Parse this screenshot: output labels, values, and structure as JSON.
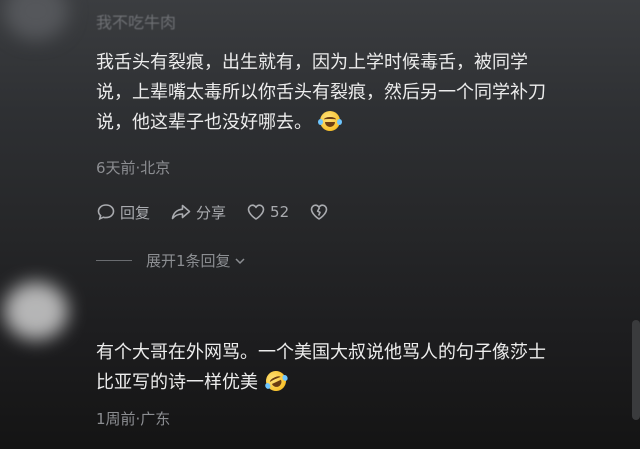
{
  "comments": [
    {
      "username": "我不吃牛肉",
      "lines": [
        "我舌头有裂痕，出生就有，因为上学时候毒舌，被同学",
        "说，上辈嘴太毒所以你舌头有裂痕，然后另一个同学补刀",
        "说，他这辈子也没好哪去。"
      ],
      "emoji": "grinning-with-tears-emoji",
      "time_location": "6天前·北京",
      "reply_label": "回复",
      "share_label": "分享",
      "like_count": "52",
      "expand_replies_label": "展开1条回复"
    },
    {
      "lines": [
        "有个大哥在外网骂。一个美国大叔说他骂人的句子像莎士",
        "比亚写的诗一样优美"
      ],
      "emoji": "rolling-laughing-emoji",
      "time_location": "1周前·广东"
    }
  ],
  "colors": {
    "text_primary": "#ececec",
    "text_secondary": "#8c8e92",
    "action_text": "#a9abaf",
    "emoji_yellow": "#f8c22e"
  }
}
